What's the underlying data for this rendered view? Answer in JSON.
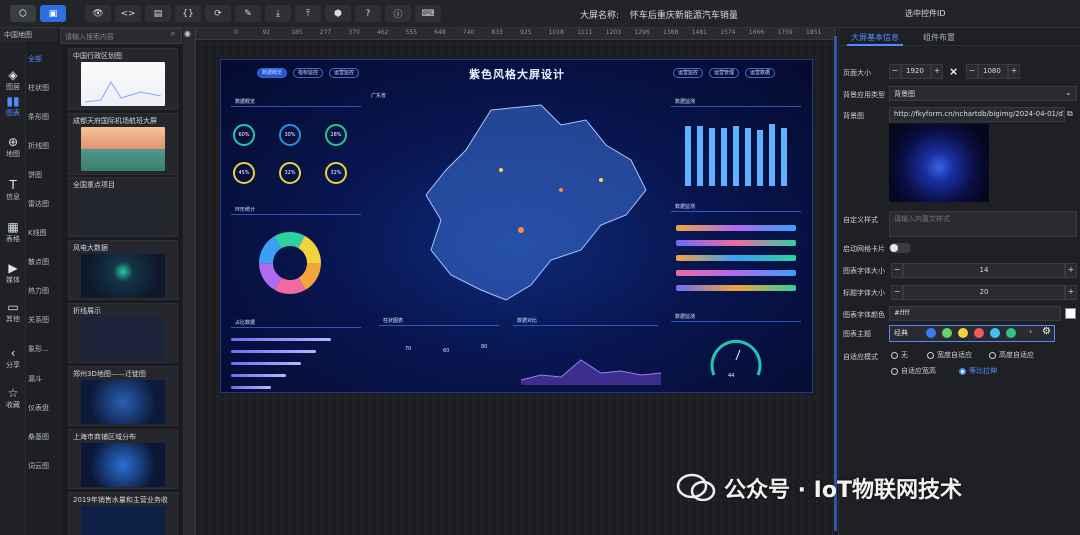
{
  "topbar": {
    "screen_name_label": "大屏名称:",
    "screen_name": "怀车后重庆新能源汽车销量",
    "right_label": "选中控件ID"
  },
  "leftnav": {
    "header": "中国地图",
    "items": [
      {
        "label": "图层",
        "icon": "layers-icon"
      },
      {
        "label": "图表",
        "icon": "chart-icon"
      },
      {
        "label": "地图",
        "icon": "map-icon"
      },
      {
        "label": "信息",
        "icon": "text-icon"
      },
      {
        "label": "表格",
        "icon": "table-icon"
      },
      {
        "label": "媒体",
        "icon": "media-icon"
      },
      {
        "label": "其他",
        "icon": "other-icon"
      },
      {
        "label": "分享",
        "icon": "share-icon"
      },
      {
        "label": "收藏",
        "icon": "star-icon"
      }
    ]
  },
  "categories": [
    "全部",
    "柱状图",
    "条形图",
    "折线图",
    "饼图",
    "雷达图",
    "K线图",
    "散点图",
    "热力图",
    "关系图",
    "象形...",
    "漏斗",
    "仪表盘",
    "桑基图",
    "词云图"
  ],
  "search": {
    "placeholder": "请输入搜索内容"
  },
  "templates": [
    {
      "name": "中国行政区划图"
    },
    {
      "name": "成都天府国际机场航班大屏"
    },
    {
      "name": "全国重点项目"
    },
    {
      "name": "风电大数据"
    },
    {
      "name": "折线展示"
    },
    {
      "name": "郑州3D地图——迁徙图"
    },
    {
      "name": "上海市商铺区域分布"
    },
    {
      "name": "2019年销售水量和主营业务收"
    }
  ],
  "ruler": [
    "0",
    "92",
    "185",
    "277",
    "370",
    "462",
    "555",
    "648",
    "740",
    "833",
    "925",
    "1018",
    "1111",
    "1203",
    "1296",
    "1388",
    "1481",
    "1574",
    "1666",
    "1759",
    "1851",
    "1944"
  ],
  "dashboard": {
    "title": "紫色风格大屏设计",
    "tabs_left": [
      "数据概览",
      "指标监控",
      "运营监控"
    ],
    "tabs_right": [
      "运营监控",
      "运营管理",
      "运营数据"
    ],
    "panels": [
      "数据概览",
      "环形统计",
      "占比数据",
      "数据监测",
      "数据监测",
      "柱状图表",
      "数据对比",
      "数据监测"
    ],
    "map_title": "广东省",
    "rings": [
      {
        "value": "60%",
        "label": "指标"
      },
      {
        "value": "30%",
        "label": "指标"
      },
      {
        "value": "28%",
        "label": "指标"
      },
      {
        "value": "45%",
        "label": "指标"
      },
      {
        "value": "32%",
        "label": "指标"
      },
      {
        "value": "32%",
        "label": "指标"
      }
    ],
    "bar_values": [
      70,
      60,
      80
    ],
    "gauge_value": "44"
  },
  "rightpanel": {
    "tabs": [
      "大屏基本信息",
      "组件布置"
    ],
    "screen_size_label": "页面大小",
    "width": "1920",
    "height": "1080",
    "bg_type_label": "背景应用类型",
    "bg_type_value": "背景图",
    "bg_image_label": "背景图",
    "bg_image_url": "http://fkyform.cn/nchartdb/bigimg/2024-04-01/d7",
    "custom_style_label": "自定义样式",
    "custom_style_placeholder": "请输入内置文样式",
    "grid_label": "启动网格卡片",
    "chart_font_size_label": "图表字体大小",
    "chart_font_size": "14",
    "title_font_size_label": "标题字体大小",
    "title_font_size": "20",
    "chart_font_color_label": "图表字体颜色",
    "chart_font_color": "#ffff",
    "theme_label": "图表主题",
    "theme_name": "经典",
    "theme_colors": [
      "#3b7bf5",
      "#65d36b",
      "#f2d33f",
      "#ee5a5a",
      "#42c2f2",
      "#2fc48a"
    ],
    "adapt_label": "自适应模式",
    "adapt_options": [
      "无",
      "宽度自适应",
      "高度自适应",
      "自适应宽高",
      "等比拉伸"
    ],
    "adapt_selected": 4
  },
  "watermark": "公众号 · IoT物联网技术"
}
